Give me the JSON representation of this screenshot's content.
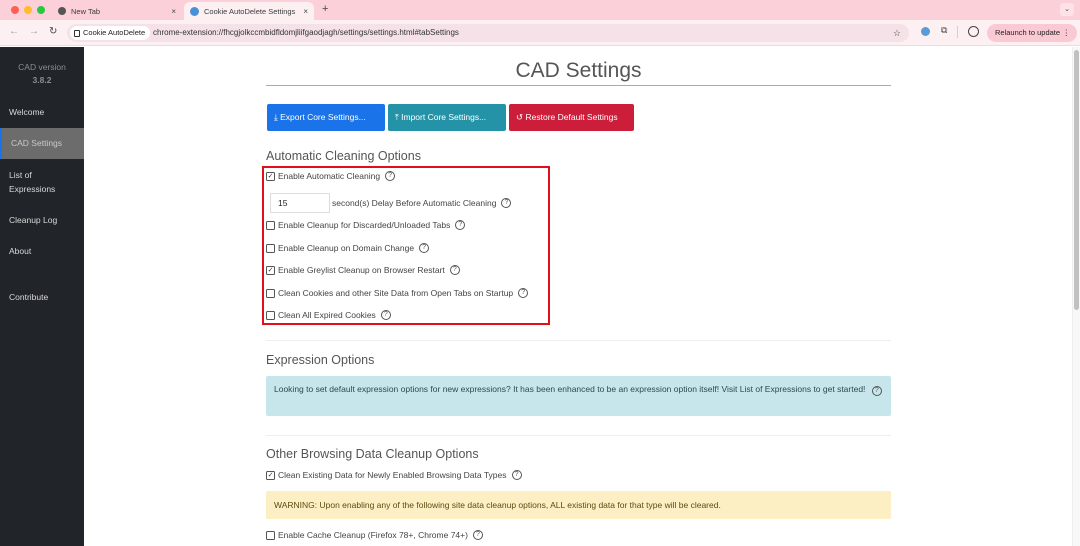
{
  "browser": {
    "tabs": [
      {
        "label": "New Tab",
        "active": false
      },
      {
        "label": "Cookie AutoDelete Settings",
        "active": true
      }
    ],
    "site_chip": "Cookie AutoDelete",
    "url": "chrome-extension://fhcgjolkccmbidfldomjliifgaodjagh/settings/settings.html#tabSettings",
    "relaunch_label": "Relaunch to update",
    "icons": {
      "back": "←",
      "forward": "→",
      "reload": "↻",
      "star": "☆",
      "close": "×",
      "new_tab": "+",
      "tab_menu": "⌄",
      "more": "⋮",
      "extensions": "⧉"
    }
  },
  "sidebar": {
    "version_label": "CAD version",
    "version_number": "3.8.2",
    "items": [
      {
        "label": "Welcome"
      },
      {
        "label": "CAD Settings",
        "active": true
      },
      {
        "label": "List of"
      },
      {
        "label": "Expressions"
      },
      {
        "label": "Cleanup Log"
      },
      {
        "label": "About"
      },
      {
        "label": "Contribute"
      }
    ]
  },
  "main": {
    "title": "CAD Settings",
    "buttons": {
      "export": "Export Core Settings...",
      "import": "Import Core Settings...",
      "restore": "Restore Default Settings",
      "export_icon": "⤓",
      "import_icon": "⤒",
      "restore_icon": "↺"
    },
    "automatic_cleaning": {
      "heading": "Automatic Cleaning Options",
      "enable_auto": {
        "label": "Enable Automatic Cleaning",
        "checked": true
      },
      "delay": {
        "value": "15",
        "label": "second(s) Delay Before Automatic Cleaning"
      },
      "options": [
        {
          "label": "Enable Cleanup for Discarded/Unloaded Tabs",
          "checked": false
        },
        {
          "label": "Enable Cleanup on Domain Change",
          "checked": false
        },
        {
          "label": "Enable Greylist Cleanup on Browser Restart",
          "checked": true
        },
        {
          "label": "Clean Cookies and other Site Data from Open Tabs on Startup",
          "checked": false
        },
        {
          "label": "Clean All Expired Cookies",
          "checked": false
        }
      ]
    },
    "expression_options": {
      "heading": "Expression Options",
      "info": "Looking to set default expression options for new expressions? It has been enhanced to be an expression option itself! Visit List of Expressions to get started!"
    },
    "other_browsing": {
      "heading": "Other Browsing Data Cleanup Options",
      "clean_existing": {
        "label": "Clean Existing Data for Newly Enabled Browsing Data Types",
        "checked": true
      },
      "warning": "WARNING: Upon enabling any of the following site data cleanup options, ALL existing data for that type will be cleared.",
      "cache": {
        "label": "Enable Cache Cleanup (Firefox 78+, Chrome 74+)",
        "checked": false
      }
    },
    "help_glyph": "?",
    "check_glyph": "✓"
  }
}
